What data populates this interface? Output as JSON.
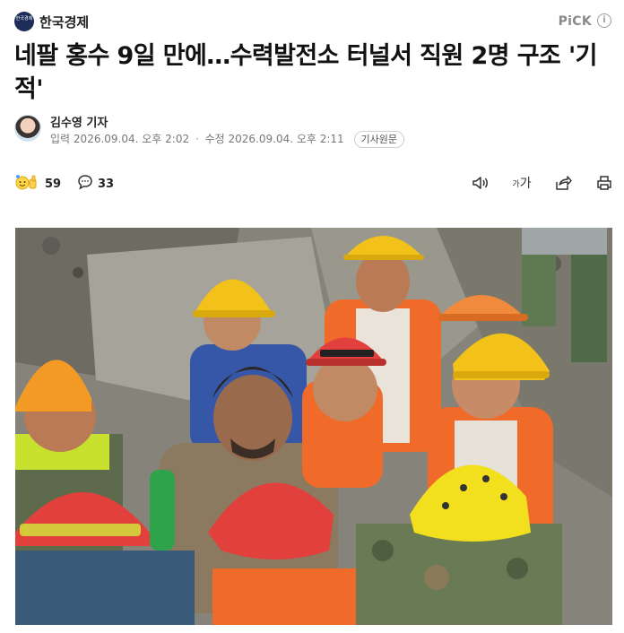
{
  "header": {
    "press_logo_text": "한국경제",
    "press_name": "한국경제",
    "pick_label": "PiCK",
    "info_glyph": "i"
  },
  "article": {
    "title": "네팔 홍수 9일 만에…수력발전소 터널서 직원 2명 구조 '기적'",
    "reporter": "김수영 기자",
    "input_label": "입력",
    "input_time": "2026.09.04. 오후 2:02",
    "modified_label": "수정",
    "modified_time": "2026.09.04. 오후 2:11",
    "original_button": "기사원문"
  },
  "toolbar": {
    "reaction_count": "59",
    "comment_count": "33",
    "font_icon_small": "가",
    "font_icon_large": "가",
    "icons": [
      "emoji-reaction-icon",
      "comment-icon",
      "audio-icon",
      "font-size-icon",
      "share-icon",
      "print-icon"
    ]
  },
  "colors": {
    "logo_bg": "#1d2d5a",
    "helmet_yellow": "#f2c21a",
    "helmet_red": "#e2403c",
    "vest_orange": "#f06a2a"
  }
}
